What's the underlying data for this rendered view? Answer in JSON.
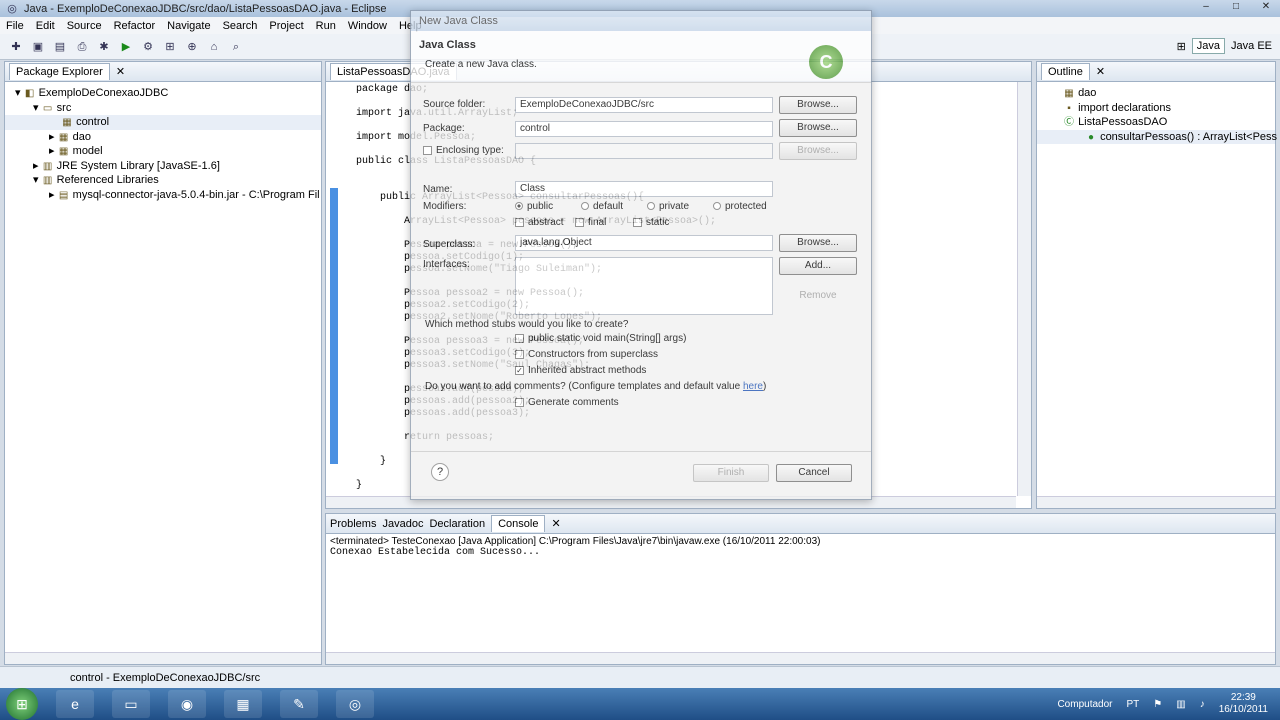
{
  "window": {
    "title": "Java - ExemploDeConexaoJDBC/src/dao/ListaPessoasDAO.java - Eclipse"
  },
  "menu": [
    "File",
    "Edit",
    "Source",
    "Refactor",
    "Navigate",
    "Search",
    "Project",
    "Run",
    "Window",
    "Help"
  ],
  "perspectives": {
    "java": "Java",
    "javaee": "Java EE"
  },
  "package_explorer": {
    "tab": "Package Explorer",
    "items": [
      {
        "label": "ExemploDeConexaoJDBC",
        "icon": "project-icon"
      },
      {
        "label": "src",
        "icon": "folder-icon"
      },
      {
        "label": "control",
        "icon": "package-icon"
      },
      {
        "label": "dao",
        "icon": "package-icon"
      },
      {
        "label": "model",
        "icon": "package-icon"
      },
      {
        "label": "JRE System Library [JavaSE-1.6]",
        "icon": "library-icon"
      },
      {
        "label": "Referenced Libraries",
        "icon": "library-icon"
      },
      {
        "label": "mysql-connector-java-5.0.4-bin.jar - C:\\Program Fil",
        "icon": "jar-icon"
      }
    ]
  },
  "editor": {
    "tab": "ListaPessoasDAO.java",
    "lines": [
      "package dao;",
      "",
      "import java.util.ArrayList;",
      "",
      "import model.Pessoa;",
      "",
      "public class ListaPessoasDAO {",
      "",
      "",
      "    public ArrayList<Pessoa> consultarPessoas(){",
      "",
      "        ArrayList<Pessoa> pessoas = new ArrayList<Pessoa>();",
      "",
      "        Pessoa pessoa = new Pessoa();",
      "        pessoa.setCodigo(1);",
      "        pessoa.setNome(\"Tiago Suleiman\");",
      "",
      "        Pessoa pessoa2 = new Pessoa();",
      "        pessoa2.setCodigo(2);",
      "        pessoa2.setNome(\"Roberto Lopes\");",
      "",
      "        Pessoa pessoa3 = new Pessoa();",
      "        pessoa3.setCodigo(3);",
      "        pessoa3.setNome(\"Saul Chagas\");",
      "",
      "        pessoas.add(pessoa);",
      "        pessoas.add(pessoa2);",
      "        pessoas.add(pessoa3);",
      "",
      "        return pessoas;",
      "",
      "    }",
      "",
      "}"
    ]
  },
  "outline": {
    "tab": "Outline",
    "items": [
      "dao",
      "import declarations",
      "ListaPessoasDAO",
      "consultarPessoas() : ArrayList<Pess"
    ]
  },
  "bottom_tabs": [
    "Problems",
    "Javadoc",
    "Declaration",
    "Console"
  ],
  "console": {
    "header": "<terminated> TesteConexao [Java Application] C:\\Program Files\\Java\\jre7\\bin\\javaw.exe (16/10/2011 22:00:03)",
    "output": "Conexao Estabelecida com Sucesso..."
  },
  "dialog": {
    "title": "New Java Class",
    "heading": "Java Class",
    "subtitle": "Create a new Java class.",
    "source_folder_label": "Source folder:",
    "source_folder_value": "ExemploDeConexaoJDBC/src",
    "package_label": "Package:",
    "package_value": "control",
    "enclosing_label": "Enclosing type:",
    "name_label": "Name:",
    "name_value": "Class",
    "modifiers_label": "Modifiers:",
    "mod_public": "public",
    "mod_default": "default",
    "mod_private": "private",
    "mod_protected": "protected",
    "mod_abstract": "abstract",
    "mod_final": "final",
    "mod_static": "static",
    "superclass_label": "Superclass:",
    "superclass_value": "java.lang.Object",
    "interfaces_label": "Interfaces:",
    "stubs_question": "Which method stubs would you like to create?",
    "stub_main": "public static void main(String[] args)",
    "stub_constructors": "Constructors from superclass",
    "stub_inherited": "Inherited abstract methods",
    "comments_question": "Do you want to add comments? (Configure templates and default value",
    "comments_link": "here",
    "comments_close": ")",
    "generate_comments": "Generate comments",
    "browse": "Browse...",
    "add": "Add...",
    "remove": "Remove",
    "finish": "Finish",
    "cancel": "Cancel",
    "help": "?"
  },
  "status": {
    "text": "control - ExemploDeConexaoJDBC/src"
  },
  "taskbar": {
    "computer": "Computador",
    "lang": "PT",
    "time": "22:39",
    "date": "16/10/2011"
  }
}
